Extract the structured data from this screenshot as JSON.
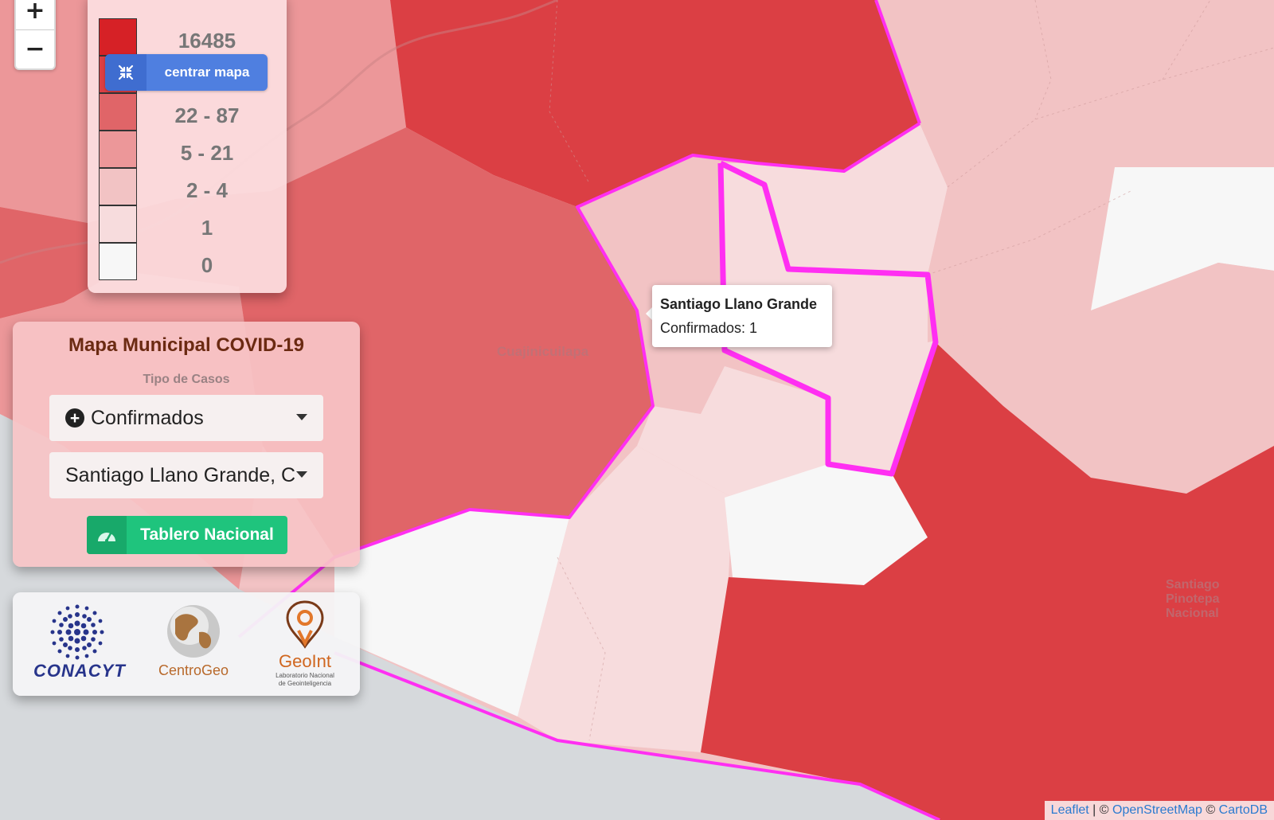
{
  "map": {
    "labels": [
      "Cuajinicuilapa",
      "Santiago Pinotepa Nacional"
    ],
    "colors": {
      "ocean": "#d6d9dc",
      "class_16485": "#d62126",
      "class_88": "#db3f44",
      "class_22_87": "#e06568",
      "class_5_21": "#ec9799",
      "class_2_4": "#f2c3c4",
      "class_1": "#f7dcdd",
      "class_0": "#f7f7f7",
      "highlight": "#ff2ff2"
    }
  },
  "zoom": {
    "in_label": "+",
    "out_label": "−"
  },
  "legend": {
    "labels": [
      "16485",
      "22 - 87",
      "5 - 21",
      "2 - 4",
      "1",
      "0"
    ],
    "center_button": {
      "label": "centrar mapa",
      "icon": "compress-icon"
    }
  },
  "panel": {
    "title": "Mapa Municipal COVID-19",
    "subtitle": "Tipo de Casos",
    "case_type": {
      "value": "Confirmados",
      "icon": "plus-circle-icon"
    },
    "municipality": {
      "value": "Santiago Llano Grande, C"
    },
    "dashboard_button": {
      "label": "Tablero Nacional",
      "icon": "dashboard-icon"
    }
  },
  "logos": {
    "conacyt": "CONACYT",
    "centrogeo": "CentroGeo",
    "geoint": "GeoInt",
    "geoint_subtitle_1": "Laboratorio Nacional",
    "geoint_subtitle_2": "de Geointeligencia"
  },
  "tooltip": {
    "name": "Santiago Llano Grande",
    "value": "Confirmados: 1"
  },
  "attribution": {
    "leaflet": "Leaflet",
    "sep1": " | © ",
    "osm": "OpenStreetMap",
    "sep2": " © ",
    "carto": "CartoDB"
  }
}
